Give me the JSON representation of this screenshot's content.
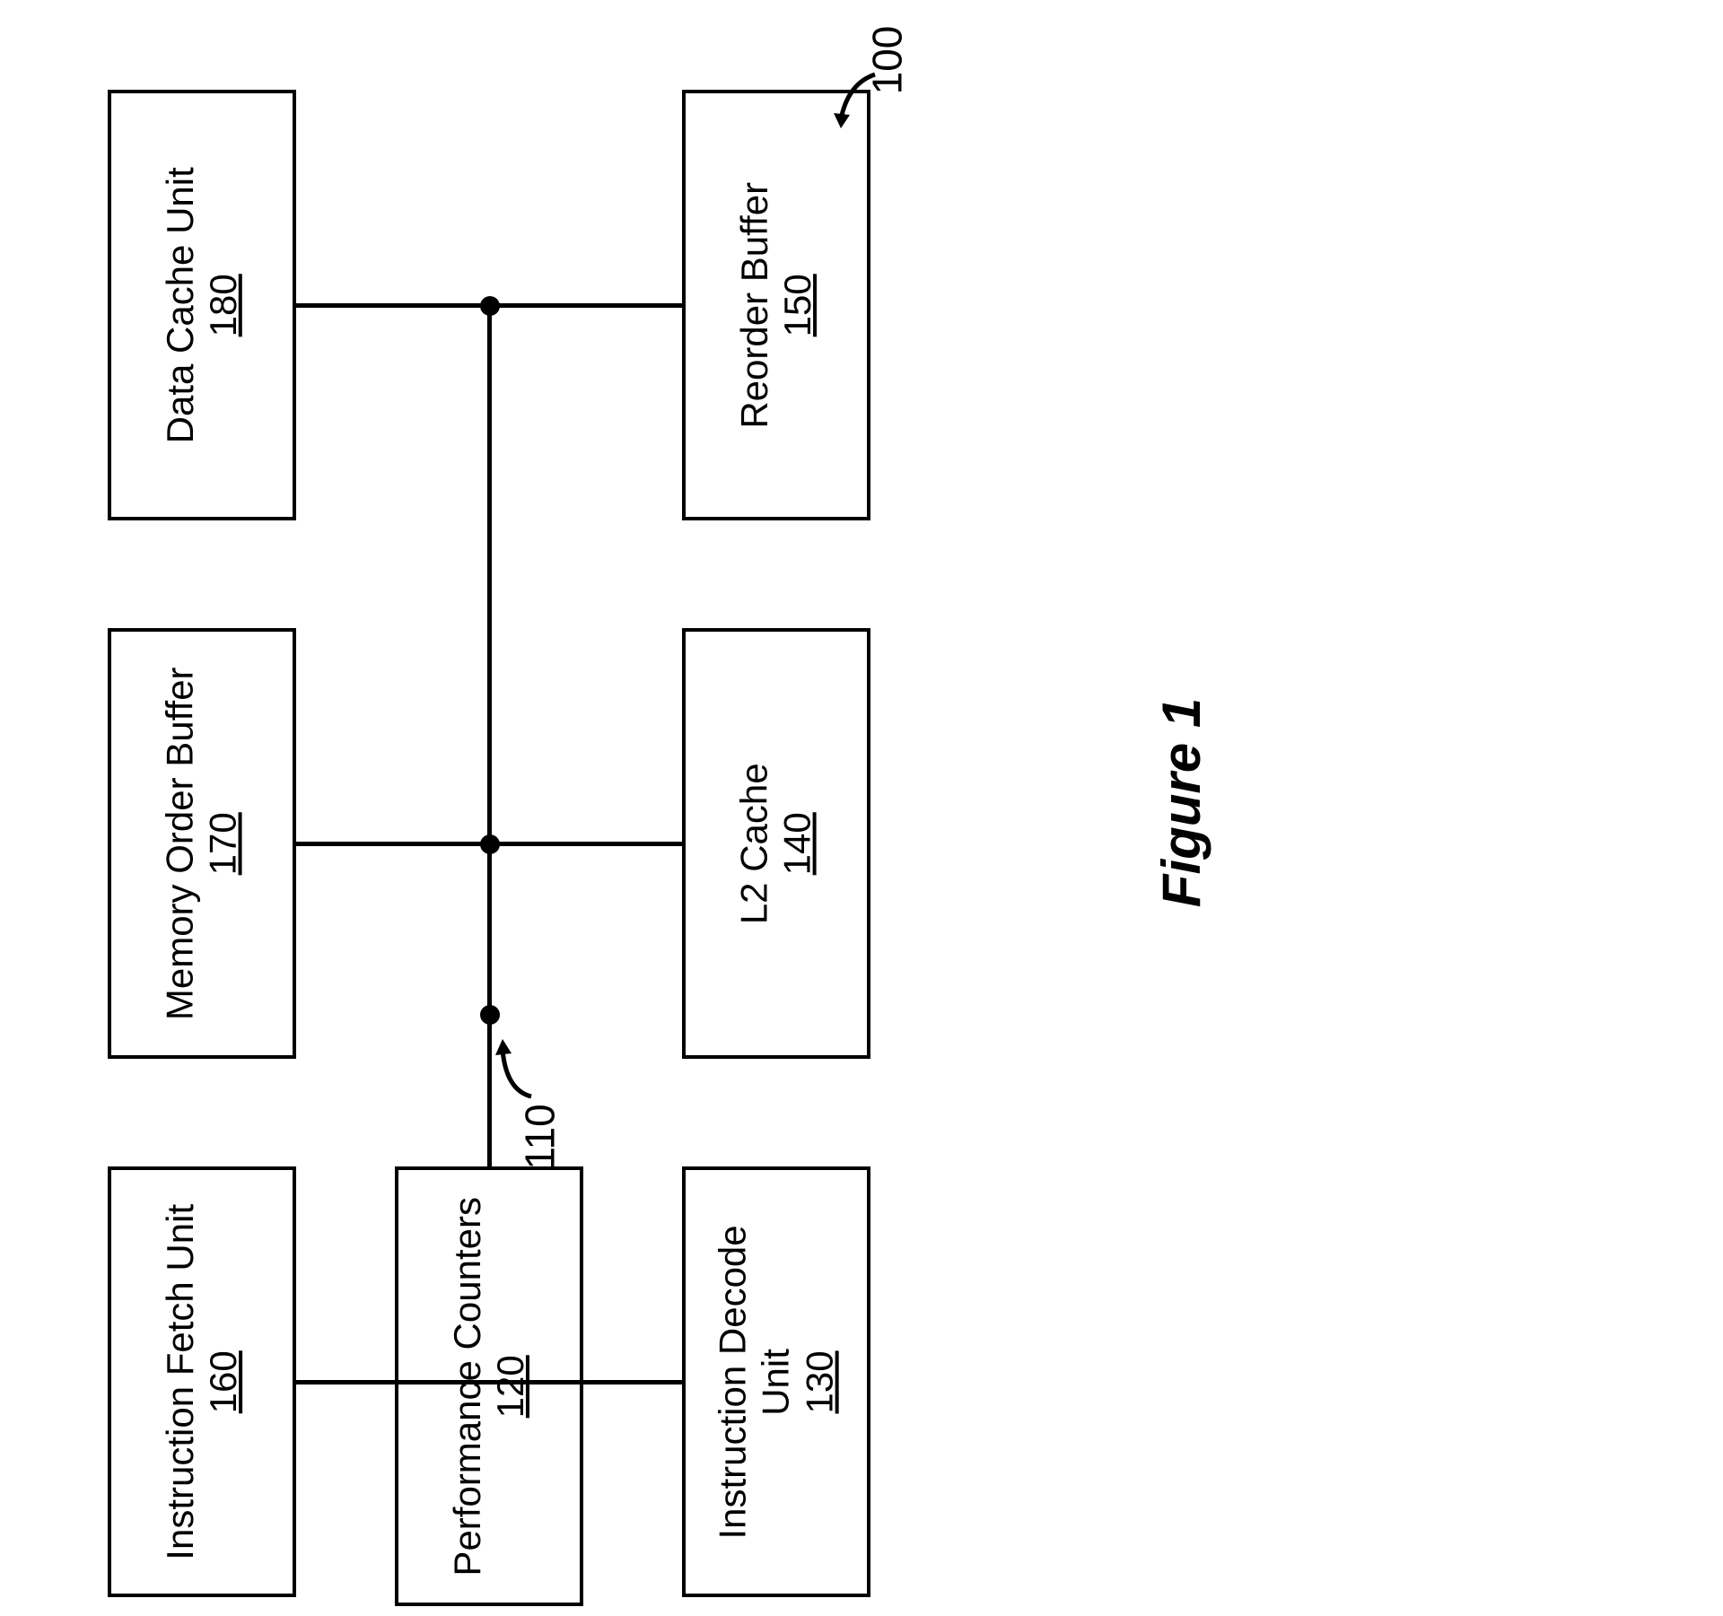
{
  "diagram": {
    "overall_label": "100",
    "bus_label": "110",
    "figure": "Figure 1",
    "blocks": {
      "data_cache_unit": {
        "title": "Data Cache Unit",
        "ref": "180"
      },
      "memory_order_buffer": {
        "title": "Memory Order Buffer",
        "ref": "170"
      },
      "instruction_fetch_unit": {
        "title": "Instruction Fetch Unit",
        "ref": "160"
      },
      "reorder_buffer": {
        "title": "Reorder Buffer",
        "ref": "150"
      },
      "l2_cache": {
        "title": "L2 Cache",
        "ref": "140"
      },
      "instruction_decode_unit": {
        "title": "Instruction Decode",
        "subtitle": "Unit",
        "ref": "130"
      },
      "performance_counters": {
        "title": "Performance Counters",
        "ref": "120"
      }
    }
  }
}
